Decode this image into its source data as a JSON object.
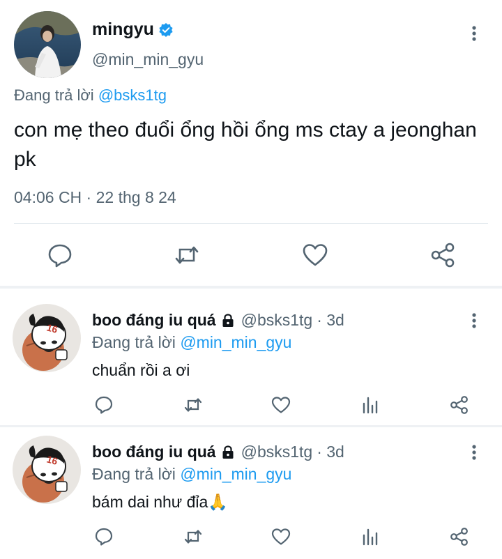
{
  "main_tweet": {
    "display_name": "mingyu",
    "handle": "@min_min_gyu",
    "replying_prefix": "Đang trả lời ",
    "replying_to": "@bsks1tg",
    "text": "con mẹ theo đuổi ổng hồi ổng ms ctay a jeonghan pk",
    "timestamp": "04:06 CH · 22 thg 8 24",
    "verified_color": "#1d9bf0",
    "action_icons": [
      "reply-icon",
      "retweet-icon",
      "like-icon",
      "share-icon"
    ]
  },
  "replies": [
    {
      "display_name": "boo đáng iu quá",
      "handle": "@bsks1tg",
      "time": "· 3d",
      "replying_prefix": "Đang trả lời ",
      "replying_to": "@min_min_gyu",
      "text": "chuẩn rồi a ơi"
    },
    {
      "display_name": "boo đáng iu quá",
      "handle": "@bsks1tg",
      "time": "· 3d",
      "replying_prefix": "Đang trả lời ",
      "replying_to": "@min_min_gyu",
      "text": "bám dai như đỉa🙏"
    }
  ],
  "reply_action_icons": [
    "reply-icon",
    "retweet-icon",
    "like-icon",
    "views-icon",
    "share-icon"
  ],
  "colors": {
    "accent": "#1d9bf0",
    "secondary_text": "#536471",
    "icon": "#536471"
  }
}
